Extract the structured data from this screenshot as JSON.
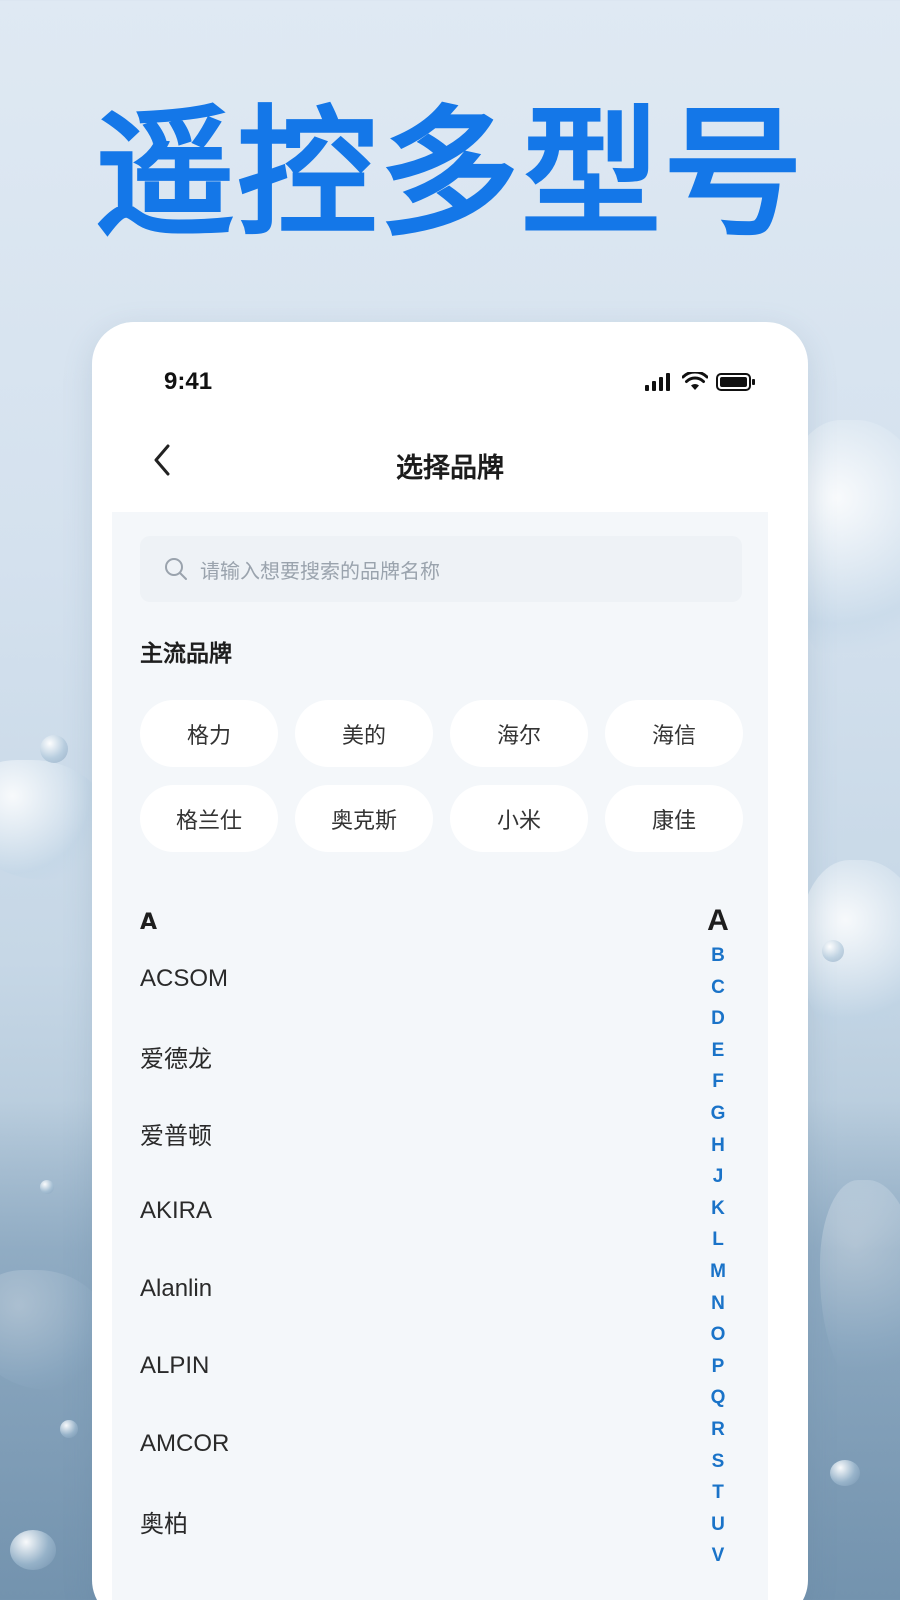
{
  "hero": {
    "title": "遥控多型号"
  },
  "status_bar": {
    "time": "9:41"
  },
  "nav": {
    "title": "选择品牌"
  },
  "search": {
    "placeholder": "请输入想要搜索的品牌名称"
  },
  "popular": {
    "title": "主流品牌",
    "brands": [
      "格力",
      "美的",
      "海尔",
      "海信",
      "格兰仕",
      "奥克斯",
      "小米",
      "康佳"
    ]
  },
  "brand_list": {
    "group_letter": "A",
    "items": [
      "ACSOM",
      "爱德龙",
      "爱普顿",
      "AKIRA",
      "Alanlin",
      "ALPIN",
      "AMCOR",
      "奥柏"
    ]
  },
  "alphabet_index": {
    "current": "A",
    "letters": [
      "B",
      "C",
      "D",
      "E",
      "F",
      "G",
      "H",
      "J",
      "K",
      "L",
      "M",
      "N",
      "O",
      "P",
      "Q",
      "R",
      "S",
      "T",
      "U",
      "V"
    ]
  },
  "colors": {
    "accent": "#1477e8",
    "index_blue": "#1a73c8"
  }
}
